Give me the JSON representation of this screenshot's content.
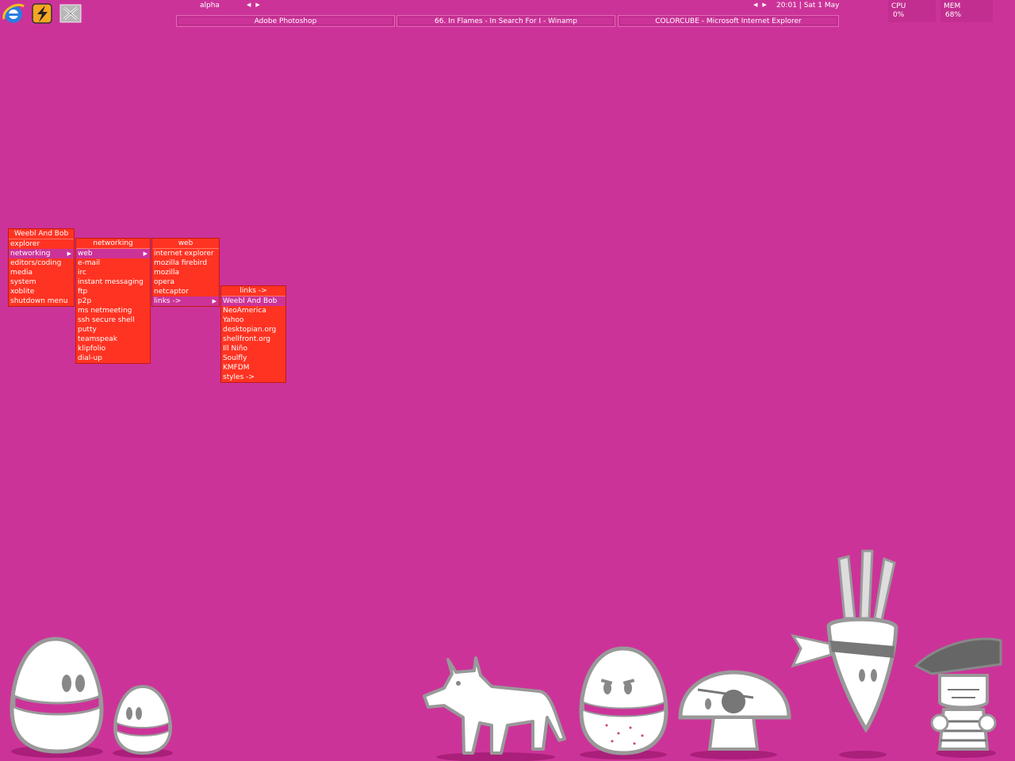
{
  "launcher": {
    "icons": [
      "internet-explorer-icon",
      "winamp-icon",
      "xoblite-icon"
    ]
  },
  "topbar": {
    "workspace": "alpha",
    "clock": "20:01 | Sat 1 May"
  },
  "tasks": [
    {
      "label": "Adobe Photoshop"
    },
    {
      "label": "66. In Flames - In Search For I - Winamp"
    },
    {
      "label": "COLORCUBE - Microsoft Internet Explorer"
    }
  ],
  "monitors": {
    "cpu": {
      "label": "CPU",
      "value": "0%"
    },
    "mem": {
      "label": "MEM",
      "value": "68%"
    }
  },
  "menus": {
    "root": {
      "title": "Weebl And Bob",
      "items": [
        "explorer",
        "networking",
        "editors/coding",
        "media",
        "system",
        "xoblite",
        "shutdown menu"
      ]
    },
    "networking": {
      "title": "networking",
      "items": [
        "web",
        "e-mail",
        "irc",
        "instant messaging",
        "ftp",
        "p2p",
        "ms netmeeting",
        "ssh secure shell",
        "putty",
        "teamspeak",
        "klipfolio",
        "dial-up"
      ]
    },
    "web": {
      "title": "web",
      "items": [
        "internet explorer",
        "mozilla firebird",
        "mozilla",
        "opera",
        "netcaptor",
        "links ->"
      ]
    },
    "links": {
      "title": "links ->",
      "items": [
        "Weebl And Bob",
        "NeoAmerica",
        "Yahoo",
        "desktopian.org",
        "shellfront.org",
        "Ill Niño",
        "Soulfly",
        "KMFDM",
        "styles ->"
      ]
    }
  },
  "colors": {
    "desktop": "#cc3399",
    "menu": "#ff3322",
    "menu_highlight": "#cc3399"
  }
}
